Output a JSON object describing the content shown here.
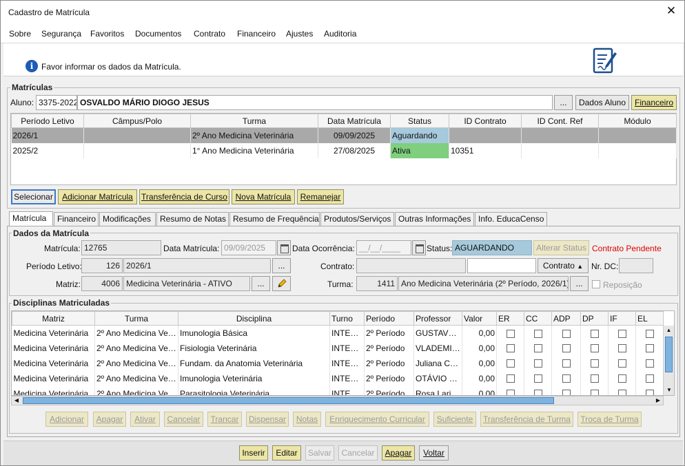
{
  "window": {
    "title": "Cadastro de Matrícula",
    "close": "✕"
  },
  "menu": [
    "Sobre",
    "Segurança",
    "Favoritos",
    "Documentos",
    "Contrato",
    "Financeiro",
    "Ajustes",
    "Auditoria"
  ],
  "info": {
    "icon": "info-icon",
    "text": "Favor informar os dados da Matrícula."
  },
  "matriculas": {
    "title": "Matrículas",
    "aluno_label": "Aluno:",
    "aluno_code": "3375-2022",
    "aluno_name": "OSVALDO MÁRIO DIOGO JESUS",
    "ellipsis": "...",
    "dados_aluno": "Dados Aluno",
    "financeiro": "Financeiro",
    "columns": [
      "Período Letivo",
      "Câmpus/Polo",
      "Turma",
      "Data Matrícula",
      "Status",
      "ID Contrato",
      "ID Cont. Ref",
      "Módulo"
    ],
    "rows": [
      {
        "periodo": "2026/1",
        "campus": "",
        "turma": "2º Ano Medicina Veterinária",
        "data": "09/09/2025",
        "status": "Aguardando",
        "id_contrato": "",
        "id_ref": "",
        "modulo": ""
      },
      {
        "periodo": "2025/2",
        "campus": "",
        "turma": "1°  Ano Medicina Veterinária",
        "data": "27/08/2025",
        "status": "Ativa",
        "id_contrato": "10351",
        "id_ref": "",
        "modulo": ""
      }
    ],
    "buttons": {
      "selecionar": "Selecionar",
      "adicionar": "Adicionar Matrícula",
      "transferencia": "Transferência de Curso",
      "nova": "Nova Matrícula",
      "remanejar": "Remanejar"
    }
  },
  "tabs": [
    "Matrícula",
    "Financeiro",
    "Modificações",
    "Resumo de Notas",
    "Resumo de Frequência",
    "Produtos/Serviços",
    "Outras Informações",
    "Info. EducaCenso"
  ],
  "dados": {
    "title": "Dados da Matrícula",
    "matricula_label": "Matrícula:",
    "matricula": "12765",
    "data_label": "Data Matrícula:",
    "data": "09/09/2025",
    "ocorrencia_label": "Data Ocorrência:",
    "ocorrencia": "__/__/____",
    "status_label": "Status:",
    "status": "AGUARDANDO",
    "alterar_status": "Alterar Status",
    "contrato_pendente": "Contrato Pendente",
    "periodo_label": "Período Letivo:",
    "periodo_code": "126",
    "periodo": "2026/1",
    "contrato_label": "Contrato:",
    "contrato_value": "",
    "contrato_num": "",
    "contrato_select": "Contrato",
    "nrdc_label": "Nr. DC:",
    "nrdc": "",
    "matriz_label": "Matriz:",
    "matriz_code": "4006",
    "matriz": "Medicina Veterinária - ATIVO",
    "turma_label": "Turma:",
    "turma_code": "1411",
    "turma": "Ano Medicina Veterinária (2º Período, 2026/1)",
    "reposicao": "Reposição"
  },
  "disciplinas": {
    "title": "Disciplinas Matriculadas",
    "columns": [
      "Matriz",
      "Turma",
      "Disciplina",
      "Turno",
      "Período",
      "Professor",
      "Valor",
      "ER",
      "CC",
      "ADP",
      "DP",
      "IF",
      "EL"
    ],
    "rows": [
      {
        "matriz": "Medicina Veterinária",
        "turma": "2º Ano Medicina Vet...",
        "disciplina": "Imunologia Básica",
        "turno": "INTEG...",
        "periodo": "2º Período",
        "professor": "GUSTAVO ...",
        "valor": "0,00"
      },
      {
        "matriz": "Medicina Veterinária",
        "turma": "2º Ano Medicina Vet...",
        "disciplina": "Fisiologia Veterinária",
        "turno": "INTEG...",
        "periodo": "2º Período",
        "professor": "VLADEMIR...",
        "valor": "0,00"
      },
      {
        "matriz": "Medicina Veterinária",
        "turma": "2º Ano Medicina Vet...",
        "disciplina": "Fundam. da Anatomia Veterinária",
        "turno": "INTEG...",
        "periodo": "2º Período",
        "professor": "Juliana Car...",
        "valor": "0,00"
      },
      {
        "matriz": "Medicina Veterinária",
        "turma": "2º Ano Medicina Vet...",
        "disciplina": "Imunologia Veterinária",
        "turno": "INTEG...",
        "periodo": "2º Período",
        "professor": "OTÁVIO EL...",
        "valor": "0,00"
      },
      {
        "matriz": "Medicina Veterinária",
        "turma": "2º Ano Medicina Vet...",
        "disciplina": "Parasitologia Veterinária",
        "turno": "INTEG...",
        "periodo": "2º Período",
        "professor": "Rosa Lariss...",
        "valor": "0,00"
      }
    ],
    "buttons": [
      "Adicionar",
      "Apagar",
      "Ativar",
      "Cancelar",
      "Trancar",
      "Dispensar",
      "Notas",
      "Enriquecimento Curricular",
      "Suficiente",
      "Transferência de Turma",
      "Troca de Turma"
    ]
  },
  "footer": {
    "inserir": "Inserir",
    "editar": "Editar",
    "salvar": "Salvar",
    "cancelar": "Cancelar",
    "apagar": "Apagar",
    "voltar": "Voltar"
  },
  "colors": {
    "selected_row": "#a9a9a9",
    "status_aguardando": "#a6c9dc",
    "status_ativa": "#7fcf7f",
    "button_yellow": "#ece6a6",
    "danger_text": "#e00000"
  }
}
